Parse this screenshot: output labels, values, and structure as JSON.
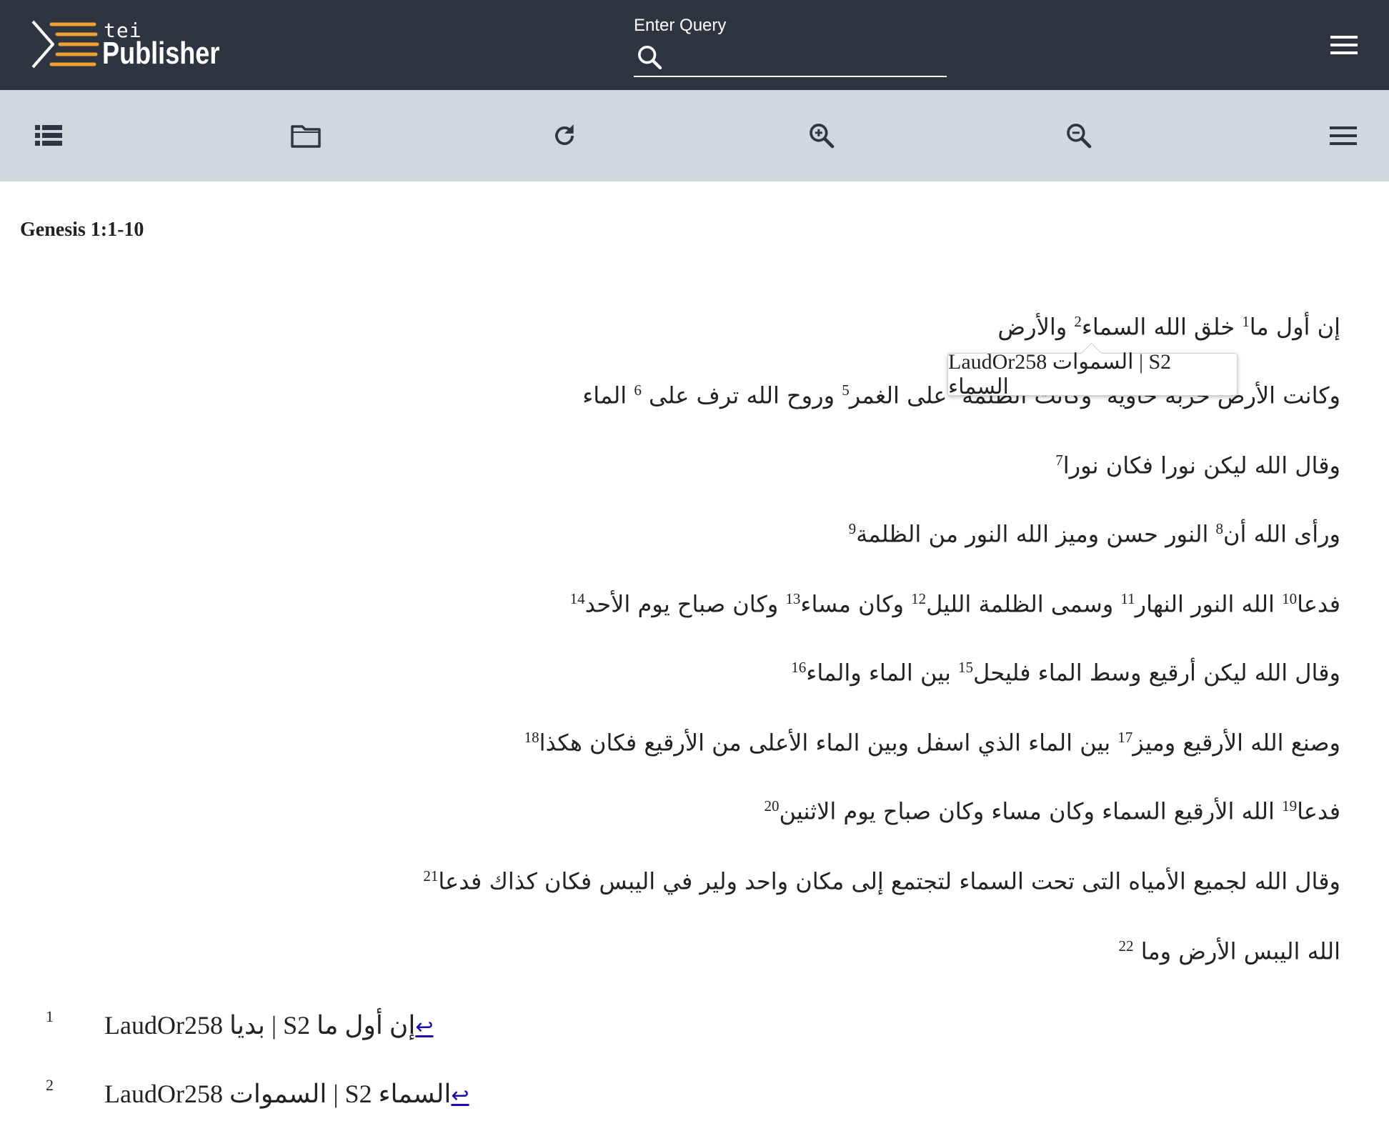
{
  "header": {
    "logo_small": "tei",
    "logo_big": "Publisher",
    "query_label": "Enter Query",
    "query_value": "",
    "icons": {
      "search": "search-icon",
      "menu": "menu-icon"
    }
  },
  "toolbar": {
    "icons": [
      "toc-list-icon",
      "folder-icon",
      "reload-icon",
      "zoom-in-icon",
      "zoom-out-icon",
      "menu-icon"
    ]
  },
  "document": {
    "title": "Genesis 1:1-10",
    "verses": [
      [
        {
          "t": "إن أول ما"
        },
        {
          "n": "1"
        },
        {
          "t": " خلق الله السماء"
        },
        {
          "n": "2"
        },
        {
          "t": " والأرض"
        }
      ],
      [
        {
          "t": "وكانت الأرض خربة خاوية"
        },
        {
          "n": "3"
        },
        {
          "t": " وكانت الظلمة"
        },
        {
          "n": "4"
        },
        {
          "t": " على الغمر"
        },
        {
          "n": "5"
        },
        {
          "t": " وروح الله ترف على "
        },
        {
          "n": "6"
        },
        {
          "t": " الماء"
        }
      ],
      [
        {
          "t": "وقال الله ليكن نورا فكان نورا"
        },
        {
          "n": "7"
        }
      ],
      [
        {
          "t": "ورأى الله أن"
        },
        {
          "n": "8"
        },
        {
          "t": " النور حسن وميز الله النور من الظلمة"
        },
        {
          "n": "9"
        }
      ],
      [
        {
          "t": "فدعا"
        },
        {
          "n": "10"
        },
        {
          "t": " الله النور النهار"
        },
        {
          "n": "11"
        },
        {
          "t": " وسمى الظلمة الليل"
        },
        {
          "n": "12"
        },
        {
          "t": " وكان مساء"
        },
        {
          "n": "13"
        },
        {
          "t": " وكان صباح يوم الأحد"
        },
        {
          "n": "14"
        }
      ],
      [
        {
          "t": "وقال الله ليكن أرقيع وسط الماء فليحل"
        },
        {
          "n": "15"
        },
        {
          "t": " بين الماء والماء"
        },
        {
          "n": "16"
        }
      ],
      [
        {
          "t": "وصنع الله الأرقيع وميز"
        },
        {
          "n": "17"
        },
        {
          "t": " بين الماء الذي اسفل وبين الماء الأعلى من الأرقيع فكان هكذا"
        },
        {
          "n": "18"
        }
      ],
      [
        {
          "t": "فدعا"
        },
        {
          "n": "19"
        },
        {
          "t": " الله الأرقيع السماء وكان مساء وكان صباح يوم الاثنين"
        },
        {
          "n": "20"
        }
      ],
      [
        {
          "t": "وقال الله لجميع الأمياه التى تحت السماء لتجتمع إلى مكان واحد ولير في اليبس فكان كذاك فدعا"
        },
        {
          "n": "21"
        }
      ],
      [
        {
          "t": "الله اليبس الأرض وما "
        },
        {
          "n": "22"
        }
      ]
    ],
    "tooltip": "LaudOr258 السموات | S2 السماء",
    "footnotes": [
      {
        "num": "1",
        "text": "LaudOr258 بديا | S2 إن أول ما",
        "backlink": "↩"
      },
      {
        "num": "2",
        "text": "LaudOr258 السموات | S2 السماء",
        "backlink": "↩"
      }
    ]
  },
  "colors": {
    "header_bg": "#2e3540",
    "toolbar_bg": "#cfd8dc",
    "logo_accent": "#f0a030",
    "link": "#1a0dab"
  }
}
